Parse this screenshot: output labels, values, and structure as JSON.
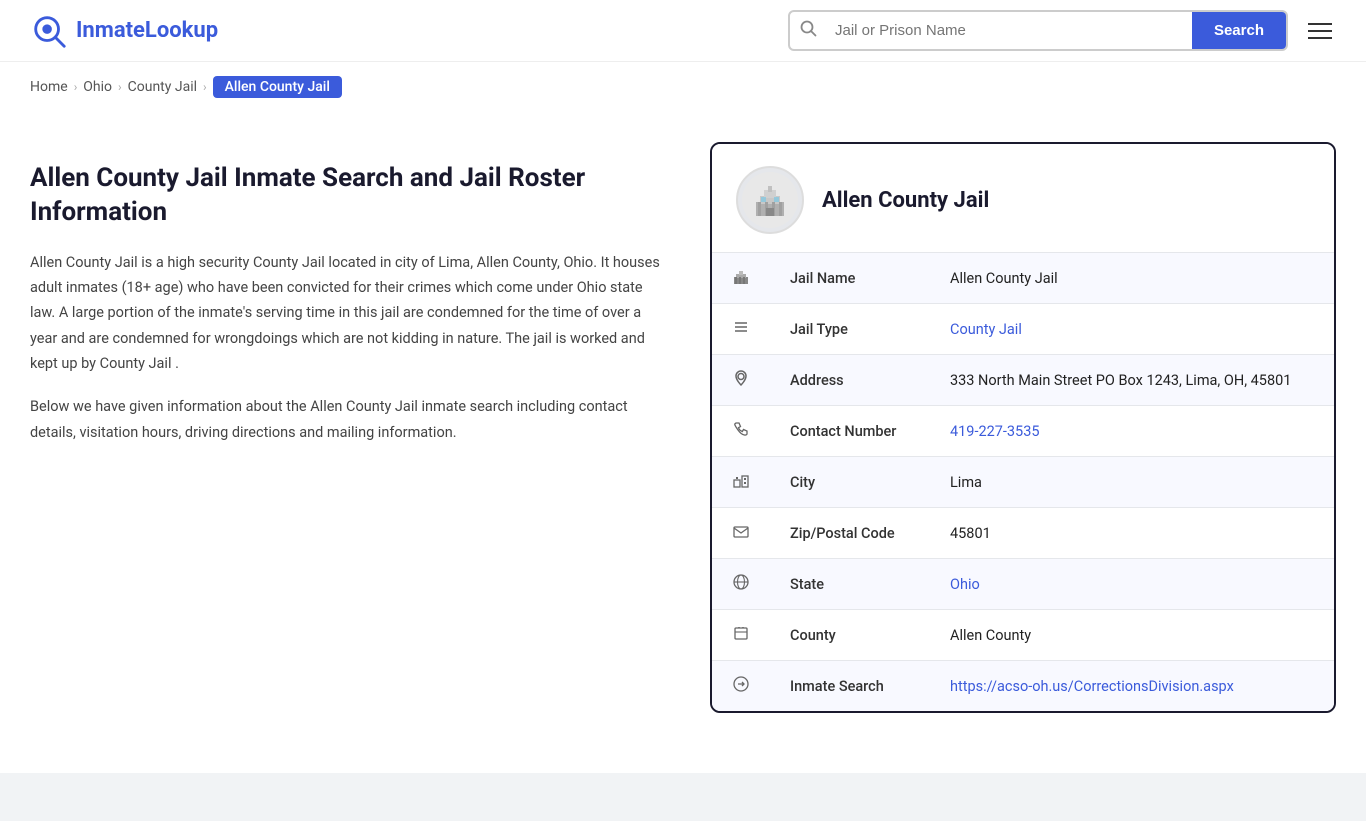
{
  "header": {
    "logo_brand": "InmateLookup",
    "logo_brand_prefix": "Inmate",
    "logo_brand_suffix": "Lookup",
    "search_placeholder": "Jail or Prison Name",
    "search_button_label": "Search"
  },
  "breadcrumb": {
    "items": [
      {
        "label": "Home",
        "href": "#"
      },
      {
        "label": "Ohio",
        "href": "#"
      },
      {
        "label": "County Jail",
        "href": "#"
      },
      {
        "label": "Allen County Jail",
        "active": true
      }
    ]
  },
  "left": {
    "title": "Allen County Jail Inmate Search and Jail Roster Information",
    "description1": "Allen County Jail is a high security County Jail located in city of Lima, Allen County, Ohio. It houses adult inmates (18+ age) who have been convicted for their crimes which come under Ohio state law. A large portion of the inmate's serving time in this jail are condemned for the time of over a year and are condemned for wrongdoings which are not kidding in nature. The jail is worked and kept up by County Jail .",
    "description2": "Below we have given information about the Allen County Jail inmate search including contact details, visitation hours, driving directions and mailing information."
  },
  "jail_card": {
    "name": "Allen County Jail",
    "rows": [
      {
        "icon": "jail-icon",
        "icon_char": "🏛",
        "label": "Jail Name",
        "value": "Allen County Jail",
        "link": false
      },
      {
        "icon": "list-icon",
        "icon_char": "≡",
        "label": "Jail Type",
        "value": "County Jail",
        "link": true,
        "href": "#"
      },
      {
        "icon": "location-icon",
        "icon_char": "📍",
        "label": "Address",
        "value": "333 North Main Street PO Box 1243, Lima, OH, 45801",
        "link": false
      },
      {
        "icon": "phone-icon",
        "icon_char": "📞",
        "label": "Contact Number",
        "value": "419-227-3535",
        "link": true,
        "href": "tel:4192273535"
      },
      {
        "icon": "city-icon",
        "icon_char": "🏙",
        "label": "City",
        "value": "Lima",
        "link": false
      },
      {
        "icon": "zip-icon",
        "icon_char": "✉",
        "label": "Zip/Postal Code",
        "value": "45801",
        "link": false
      },
      {
        "icon": "state-icon",
        "icon_char": "🌐",
        "label": "State",
        "value": "Ohio",
        "link": true,
        "href": "#"
      },
      {
        "icon": "county-icon",
        "icon_char": "📋",
        "label": "County",
        "value": "Allen County",
        "link": false
      },
      {
        "icon": "inmate-icon",
        "icon_char": "🔗",
        "label": "Inmate Search",
        "value": "https://acso-oh.us/CorrectionsDivision.aspx",
        "link": true,
        "href": "https://acso-oh.us/CorrectionsDivision.aspx"
      }
    ]
  }
}
